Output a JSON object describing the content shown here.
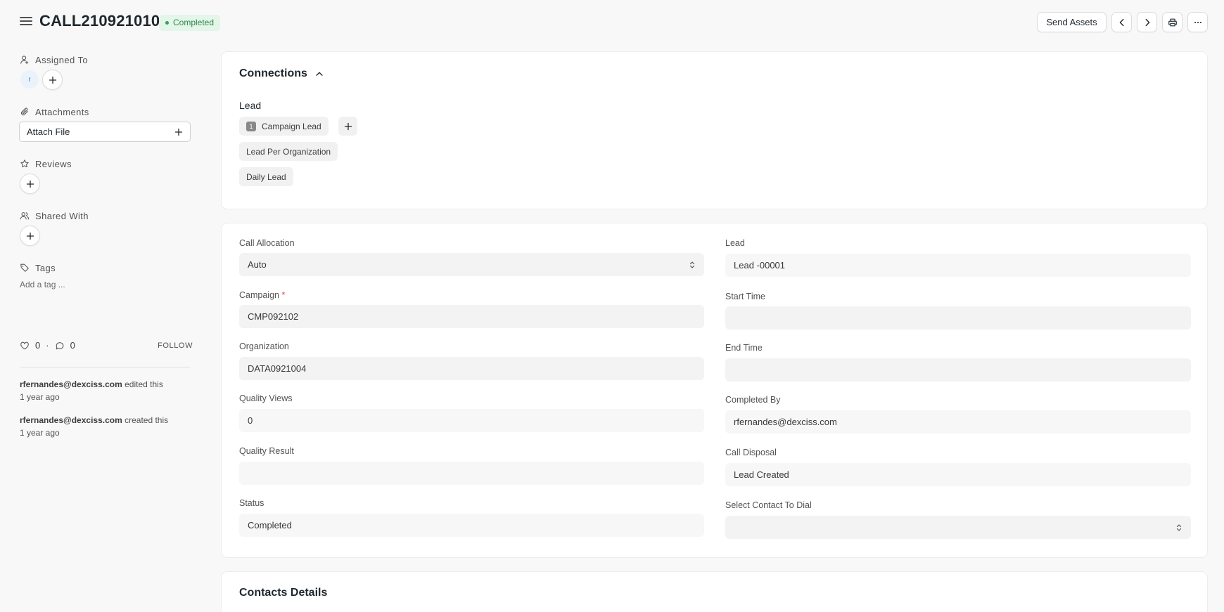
{
  "header": {
    "title": "CALL210921010",
    "status": "Completed",
    "send_assets_label": "Send Assets"
  },
  "sidebar": {
    "assigned_to_label": "Assigned To",
    "assignee_initial": "r",
    "attachments_label": "Attachments",
    "attach_file_label": "Attach File",
    "reviews_label": "Reviews",
    "shared_with_label": "Shared With",
    "tags_label": "Tags",
    "add_tag_label": "Add a tag ...",
    "likes_count": "0",
    "comments_count": "0",
    "follow_label": "FOLLOW",
    "activity": [
      {
        "user": "rfernandes@dexciss.com",
        "action": "edited this",
        "time": "1 year ago"
      },
      {
        "user": "rfernandes@dexciss.com",
        "action": "created this",
        "time": "1 year ago"
      }
    ]
  },
  "connections": {
    "title": "Connections",
    "group_label": "Lead",
    "items": [
      {
        "label": "Campaign Lead",
        "count": "1"
      },
      {
        "label": "Lead Per Organization"
      },
      {
        "label": "Daily Lead"
      }
    ]
  },
  "form": {
    "call_allocation": {
      "label": "Call Allocation",
      "value": "Auto"
    },
    "campaign": {
      "label": "Campaign",
      "required_mark": "*",
      "value": "CMP092102"
    },
    "organization": {
      "label": "Organization",
      "value": "DATA0921004"
    },
    "quality_views": {
      "label": "Quality Views",
      "value": "0"
    },
    "quality_result": {
      "label": "Quality Result",
      "value": ""
    },
    "status": {
      "label": "Status",
      "value": "Completed"
    },
    "lead": {
      "label": "Lead",
      "value": "Lead -00001"
    },
    "start_time": {
      "label": "Start Time",
      "value": ""
    },
    "end_time": {
      "label": "End Time",
      "value": ""
    },
    "completed_by": {
      "label": "Completed By",
      "value": "rfernandes@dexciss.com"
    },
    "call_disposal": {
      "label": "Call Disposal",
      "value": "Lead Created"
    },
    "select_contact": {
      "label": "Select Contact To Dial",
      "value": ""
    }
  },
  "contacts_details": {
    "title": "Contacts Details"
  },
  "colors": {
    "status_bg": "#e4f5e9",
    "status_text": "#2f8a47",
    "field_bg": "#f3f3f3",
    "page_bg": "#f8f8f8"
  }
}
